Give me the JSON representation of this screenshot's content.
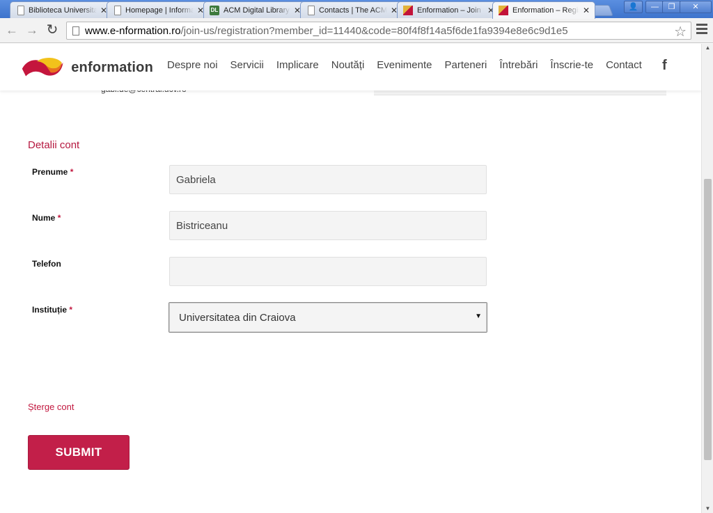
{
  "browser": {
    "tabs": [
      {
        "title": "Biblioteca Universitară",
        "favicon": "page-icon",
        "active": false
      },
      {
        "title": "Homepage | Informare",
        "favicon": "page-icon",
        "active": false
      },
      {
        "title": "ACM Digital Library",
        "favicon": "acm-icon",
        "active": false
      },
      {
        "title": "Contacts | The ACM",
        "favicon": "page-icon",
        "active": false
      },
      {
        "title": "Enformation – Join us",
        "favicon": "enformation-icon",
        "active": false
      },
      {
        "title": "Enformation – Registration",
        "favicon": "enformation-icon",
        "active": true
      }
    ],
    "url_host": "www.e-nformation.ro",
    "url_path": "/join-us/registration?member_id=11440&code=80f4f8f14a5f6de1fa9394e8e6c9d1e5"
  },
  "site": {
    "logo_text": "enformation",
    "nav": [
      "Despre noi",
      "Servicii",
      "Implicare",
      "Noutăți",
      "Evenimente",
      "Parteneri",
      "Întrebări",
      "Înscrie-te",
      "Contact"
    ],
    "social": "f"
  },
  "partial": {
    "email": "gabi.de@central.ucv.ro"
  },
  "form": {
    "section_title": "Detalii cont",
    "required_mark": "*",
    "first_name": {
      "label": "Prenume",
      "value": "Gabriela"
    },
    "last_name": {
      "label": "Nume",
      "value": "Bistriceanu"
    },
    "phone": {
      "label": "Telefon",
      "value": ""
    },
    "institution": {
      "label": "Instituție",
      "value": "Universitatea din Craiova"
    },
    "delete_link": "Șterge cont",
    "submit_label": "SUBMIT"
  },
  "colors": {
    "accent": "#c21f49",
    "tab_strip": "#3d73cc"
  }
}
